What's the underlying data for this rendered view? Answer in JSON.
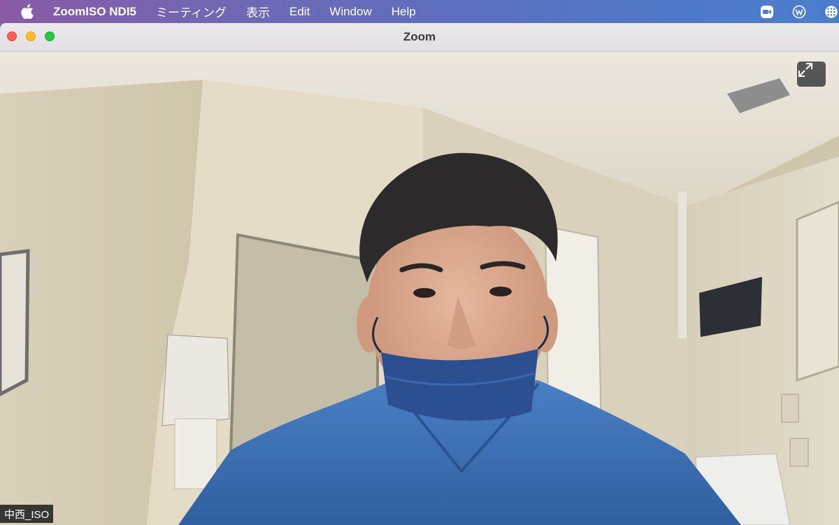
{
  "menubar": {
    "app_name": "ZoomISO NDI5",
    "items": [
      {
        "label": "ミーティング"
      },
      {
        "label": "表示"
      },
      {
        "label": "Edit"
      },
      {
        "label": "Window"
      },
      {
        "label": "Help"
      }
    ],
    "tray_icons": [
      "zoom-video-icon",
      "w-circle-icon",
      "globe-grid-icon"
    ],
    "colors": {
      "gradient_left": "#8a5aa6",
      "gradient_right": "#4a7fcc"
    }
  },
  "window": {
    "title": "Zoom",
    "traffic_lights": {
      "close": "#fe5f57",
      "minimize": "#febc2e",
      "maximize": "#28c840"
    }
  },
  "video": {
    "participant_name": "中西_ISO",
    "fullscreen_icon": "expand-arrows-icon",
    "scrub_color": "#3a6fb8",
    "mask_color": "#2b4f91"
  }
}
